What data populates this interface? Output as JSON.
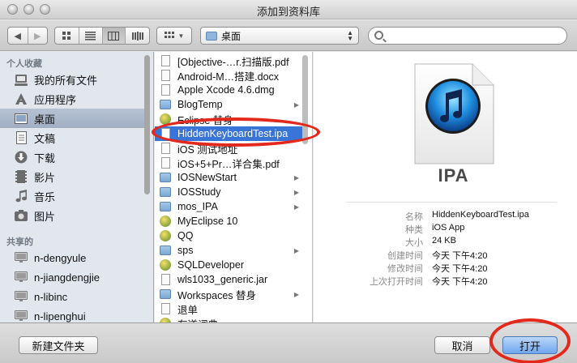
{
  "window": {
    "title": "添加到资料库"
  },
  "toolbar": {
    "back_glyph": "◀",
    "forward_glyph": "▶",
    "location": "桌面",
    "search_placeholder": ""
  },
  "sidebar": {
    "section_favorites": "个人收藏",
    "section_shared": "共享的",
    "favorites": [
      {
        "label": "我的所有文件",
        "icon": "all-files-icon"
      },
      {
        "label": "应用程序",
        "icon": "applications-icon"
      },
      {
        "label": "桌面",
        "icon": "desktop-icon",
        "selected": true
      },
      {
        "label": "文稿",
        "icon": "documents-icon"
      },
      {
        "label": "下载",
        "icon": "downloads-icon"
      },
      {
        "label": "影片",
        "icon": "movies-icon"
      },
      {
        "label": "音乐",
        "icon": "music-icon"
      },
      {
        "label": "图片",
        "icon": "pictures-icon"
      }
    ],
    "shared": [
      {
        "label": "n-dengyule",
        "icon": "computer-icon"
      },
      {
        "label": "n-jiangdengjie",
        "icon": "computer-icon"
      },
      {
        "label": "n-libinc",
        "icon": "computer-icon"
      },
      {
        "label": "n-lipenghui",
        "icon": "computer-icon"
      }
    ]
  },
  "files": [
    {
      "name": "[Objective-…r.扫描版.pdf",
      "kind": "doc"
    },
    {
      "name": "Android-M…搭建.docx",
      "kind": "doc"
    },
    {
      "name": "Apple Xcode 4.6.dmg",
      "kind": "doc"
    },
    {
      "name": "BlogTemp",
      "kind": "folder",
      "chevron": true
    },
    {
      "name": "Eclipse 替身",
      "kind": "app"
    },
    {
      "name": "HiddenKeyboardTest.ipa",
      "kind": "ipa",
      "selected": true
    },
    {
      "name": "iOS 测试地址",
      "kind": "doc"
    },
    {
      "name": "iOS+5+Pr…详合集.pdf",
      "kind": "doc"
    },
    {
      "name": "IOSNewStart",
      "kind": "folder",
      "chevron": true
    },
    {
      "name": "IOSStudy",
      "kind": "folder",
      "chevron": true
    },
    {
      "name": "mos_IPA",
      "kind": "folder",
      "chevron": true
    },
    {
      "name": "MyEclipse 10",
      "kind": "app"
    },
    {
      "name": "QQ",
      "kind": "app"
    },
    {
      "name": "sps",
      "kind": "folder",
      "chevron": true
    },
    {
      "name": "SQLDeveloper",
      "kind": "app"
    },
    {
      "name": "wls1033_generic.jar",
      "kind": "doc"
    },
    {
      "name": "Workspaces 替身",
      "kind": "folder",
      "chevron": true
    },
    {
      "name": "退单",
      "kind": "doc"
    },
    {
      "name": "有道词典",
      "kind": "app"
    }
  ],
  "preview": {
    "badge": "IPA",
    "rows": [
      {
        "key": "名称",
        "value": "HiddenKeyboardTest.ipa"
      },
      {
        "key": "种类",
        "value": "iOS App"
      },
      {
        "key": "大小",
        "value": "24 KB"
      },
      {
        "key": "创建时间",
        "value": "今天 下午4:20"
      },
      {
        "key": "修改时间",
        "value": "今天 下午4:20"
      },
      {
        "key": "上次打开时间",
        "value": "今天 下午4:20"
      }
    ]
  },
  "buttons": {
    "new_folder": "新建文件夹",
    "cancel": "取消",
    "open": "打开"
  },
  "colors": {
    "selection": "#3875d7",
    "annotation_ring": "#e2291c"
  }
}
